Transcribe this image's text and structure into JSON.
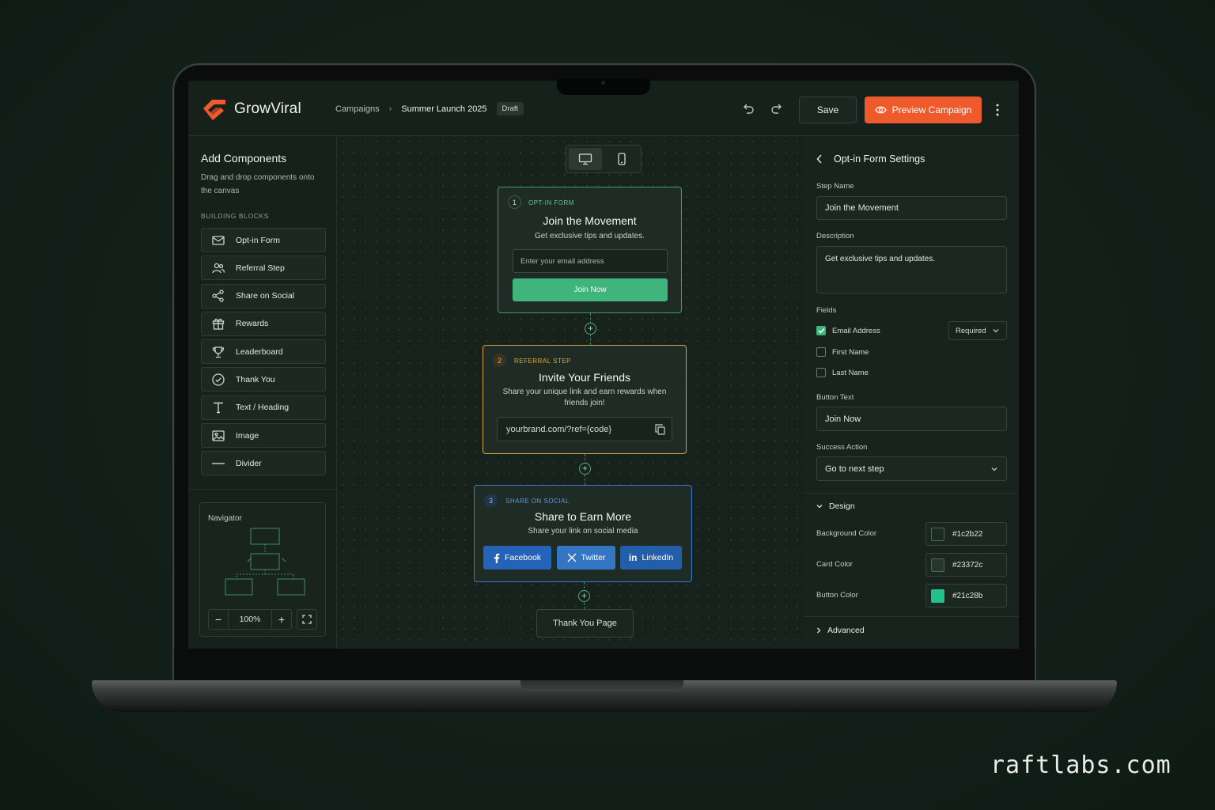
{
  "brand": {
    "name": "GrowViral",
    "accent": "#ef5a2c"
  },
  "breadcrumb": {
    "root": "Campaigns",
    "current": "Summer Launch 2025",
    "status": "Draft"
  },
  "toolbar": {
    "save_label": "Save",
    "preview_label": "Preview Campaign"
  },
  "left_panel": {
    "title": "Add Components",
    "subtitle": "Drag and drop components onto the canvas",
    "section_caption": "BUILDING BLOCKS",
    "blocks": [
      {
        "label": "Opt-in Form",
        "icon": "mail-icon"
      },
      {
        "label": "Referral Step",
        "icon": "users-icon"
      },
      {
        "label": "Share on Social",
        "icon": "share-icon"
      },
      {
        "label": "Rewards",
        "icon": "gift-icon"
      },
      {
        "label": "Leaderboard",
        "icon": "trophy-icon"
      },
      {
        "label": "Thank You",
        "icon": "check-circle-icon"
      },
      {
        "label": "Text / Heading",
        "icon": "text-icon"
      },
      {
        "label": "Image",
        "icon": "image-icon"
      },
      {
        "label": "Divider",
        "icon": "divider-icon"
      }
    ],
    "navigator": {
      "title": "Navigator",
      "zoom": "100%"
    }
  },
  "canvas": {
    "steps": [
      {
        "number": "1",
        "tag": "OPT-IN FORM",
        "title": "Join the Movement",
        "description": "Get exclusive tips and updates.",
        "input_placeholder": "Enter your email address",
        "button": "Join Now",
        "color": "#3c9c72"
      },
      {
        "number": "2",
        "tag": "REFERRAL STEP",
        "title": "Invite Your Friends",
        "description": "Share your unique link and earn rewards when friends join!",
        "link": "yourbrand.com/?ref={code}",
        "color": "#d8a23c"
      },
      {
        "number": "3",
        "tag": "SHARE ON SOCIAL",
        "title": "Share to Earn More",
        "description": "Share your link on social media",
        "buttons": [
          "Facebook",
          "Twitter",
          "LinkedIn"
        ],
        "color": "#3a78c8"
      }
    ],
    "final_step": "Thank You Page"
  },
  "settings": {
    "title": "Opt-in Form Settings",
    "step_name_label": "Step Name",
    "step_name": "Join the Movement",
    "description_label": "Description",
    "description": "Get exclusive tips and updates.",
    "fields_label": "Fields",
    "fields": [
      {
        "label": "Email Address",
        "checked": true,
        "requirement": "Required"
      },
      {
        "label": "First Name",
        "checked": false
      },
      {
        "label": "Last Name",
        "checked": false
      }
    ],
    "button_text_label": "Button Text",
    "button_text": "Join Now",
    "success_action_label": "Success Action",
    "success_action": "Go to next step",
    "design_label": "Design",
    "colors": [
      {
        "label": "Background Color",
        "value": "#1c2b22"
      },
      {
        "label": "Card Color",
        "value": "#23372c"
      },
      {
        "label": "Button Color",
        "value": "#21c28b"
      }
    ],
    "advanced_label": "Advanced"
  },
  "watermark": "raftlabs.com"
}
